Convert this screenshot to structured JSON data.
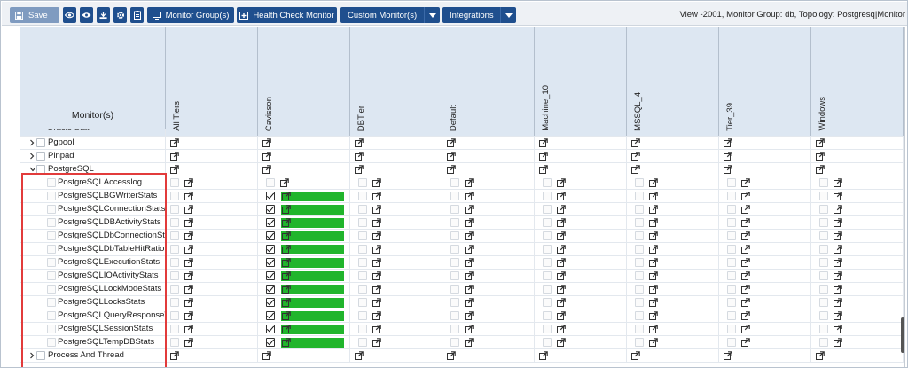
{
  "toolbar": {
    "save_label": "Save",
    "icons": [
      "eye-icon",
      "eye-icon",
      "download-icon",
      "gear-icon",
      "clipboard-icon"
    ],
    "monitor_groups_label": "Monitor Group(s)",
    "health_check_label": "Health Check Monitor",
    "custom_monitors_label": "Custom Monitor(s)",
    "integrations_label": "Integrations",
    "view_info": "View -2001, Monitor Group: db, Topology: Postgresq|Monitor"
  },
  "table": {
    "monitor_header": "Monitor(s)",
    "tiers": [
      "All Tiers",
      "Cavisson",
      "DBTier",
      "Default",
      "Machine_10",
      "MSSQL_4",
      "Tier_39",
      "Windows"
    ],
    "partial_row_label": "Oracle Stat",
    "parent_rows": [
      {
        "label": "Pgpool",
        "expanded": false
      },
      {
        "label": "Pinpad",
        "expanded": false
      },
      {
        "label": "PostgreSQL",
        "expanded": true
      }
    ],
    "child_rows": [
      {
        "label": "PostgreSQLAccesslog",
        "cavisson_checked": false
      },
      {
        "label": "PostgreSQLBGWriterStats",
        "cavisson_checked": true
      },
      {
        "label": "PostgreSQLConnectionStats",
        "cavisson_checked": true
      },
      {
        "label": "PostgreSQLDBActivityStats",
        "cavisson_checked": true
      },
      {
        "label": "PostgreSQLDbConnectionStati",
        "cavisson_checked": true
      },
      {
        "label": "PostgreSQLDbTableHitRatio",
        "cavisson_checked": true
      },
      {
        "label": "PostgreSQLExecutionStats",
        "cavisson_checked": true
      },
      {
        "label": "PostgreSQLIOActivityStats",
        "cavisson_checked": true
      },
      {
        "label": "PostgreSQLLockModeStats",
        "cavisson_checked": true
      },
      {
        "label": "PostgreSQLLocksStats",
        "cavisson_checked": true
      },
      {
        "label": "PostgreSQLQueryResponseTin",
        "cavisson_checked": true
      },
      {
        "label": "PostgreSQLSessionStats",
        "cavisson_checked": true
      },
      {
        "label": "PostgreSQLTempDBStats",
        "cavisson_checked": true
      }
    ],
    "last_row": {
      "label": "Process And Thread",
      "expanded": false
    },
    "colors": {
      "enabled_green": "#21b52c",
      "highlight_red": "#e23b3b",
      "header_bg": "#dde7f2",
      "button_blue": "#1f4f8e"
    }
  }
}
